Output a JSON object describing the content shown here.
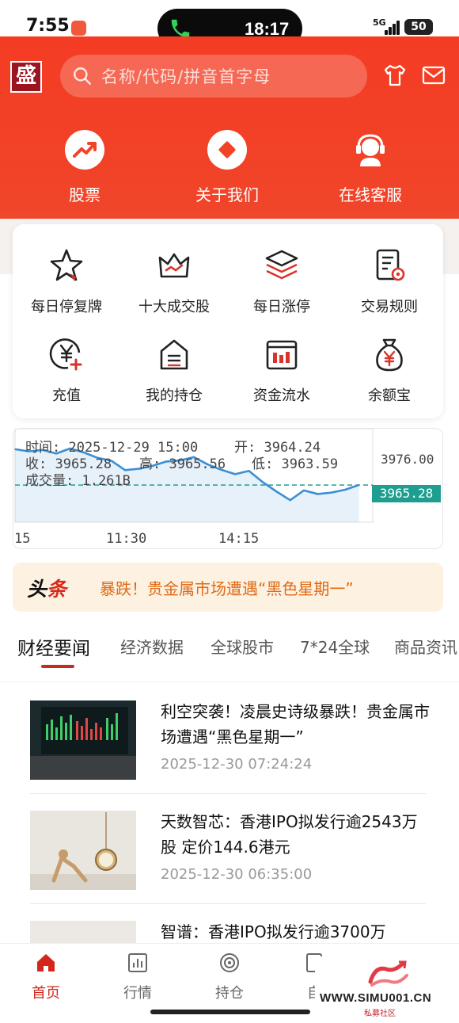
{
  "status_bar": {
    "time": "7:55",
    "call_time": "18:17",
    "network": "5G",
    "battery": "50"
  },
  "header": {
    "logo_char": "盛",
    "search_placeholder": "名称/代码/拼音首字母",
    "quick_links": [
      {
        "label": "股票",
        "icon": "trend-up-icon"
      },
      {
        "label": "关于我们",
        "icon": "diamond-icon"
      },
      {
        "label": "在线客服",
        "icon": "headset-icon"
      }
    ]
  },
  "card_grid": [
    {
      "label": "每日停复牌",
      "icon": "star-icon"
    },
    {
      "label": "十大成交股",
      "icon": "crown-icon"
    },
    {
      "label": "每日涨停",
      "icon": "layers-icon"
    },
    {
      "label": "交易规则",
      "icon": "rules-doc-icon"
    },
    {
      "label": "充值",
      "icon": "yen-plus-icon"
    },
    {
      "label": "我的持仓",
      "icon": "house-icon"
    },
    {
      "label": "资金流水",
      "icon": "bar-report-icon"
    },
    {
      "label": "余额宝",
      "icon": "money-bag-icon"
    }
  ],
  "chart_info": {
    "time": "时间: 2025-12-29 15:00",
    "open": "开: 3964.24",
    "close": "收: 3965.28",
    "high": "高: 3965.56",
    "low": "低: 3963.59",
    "volume": "成交量: 1.261B",
    "top_price": "3976.00",
    "current_price": "3965.28",
    "x_labels": [
      "15",
      "11:30",
      "14:15"
    ]
  },
  "chart_data": {
    "type": "line",
    "title": "",
    "xlabel": "",
    "ylabel": "",
    "ylim": [
      3955,
      3980
    ],
    "x": [
      0,
      1,
      2,
      3,
      4,
      5,
      6,
      7,
      8,
      9,
      10,
      11,
      12,
      13,
      14,
      15,
      16,
      17,
      18,
      19,
      20,
      21,
      22,
      23,
      24,
      25
    ],
    "series": [
      {
        "values": [
          3975.2,
          3974.6,
          3975.0,
          3974.0,
          3975.4,
          3974.3,
          3972.8,
          3972.0,
          3969.4,
          3969.8,
          3970.6,
          3971.8,
          3972.1,
          3973.0,
          3971.0,
          3969.5,
          3968.3,
          3969.2,
          3966.1,
          3963.5,
          3961.1,
          3963.8,
          3962.8,
          3963.2,
          3964.0,
          3965.3
        ]
      }
    ],
    "reference_line": 3965.28
  },
  "headline": {
    "tag_black": "头",
    "tag_red": "条",
    "text": "暴跌！贵金属市场遭遇“黑色星期一”"
  },
  "tabs": [
    "财经要闻",
    "经济数据",
    "全球股市",
    "7*24全球",
    "商品资讯"
  ],
  "news": [
    {
      "title": "利空突袭！凌晨史诗级暴跌！贵金属市场遭遇“黑色星期一”",
      "time": "2025-12-30 07:24:24"
    },
    {
      "title": "天数智芯：香港IPO拟发行逾2543万股 定价144.6港元",
      "time": "2025-12-30 06:35:00"
    },
    {
      "title": "智谱：香港IPO拟发行逾3700万",
      "time": ""
    }
  ],
  "bottom_nav": [
    {
      "label": "首页",
      "icon": "home-icon"
    },
    {
      "label": "行情",
      "icon": "chart-bars-icon"
    },
    {
      "label": "持仓",
      "icon": "target-icon"
    },
    {
      "label": "自",
      "icon": "bookmark-icon"
    }
  ],
  "watermark": {
    "url": "WWW.SIMU001.CN",
    "sub": "私募社区"
  },
  "colors": {
    "brand_red": "#f14328",
    "accent_teal": "#1e9e8f",
    "line_blue": "#3a8fd6"
  }
}
